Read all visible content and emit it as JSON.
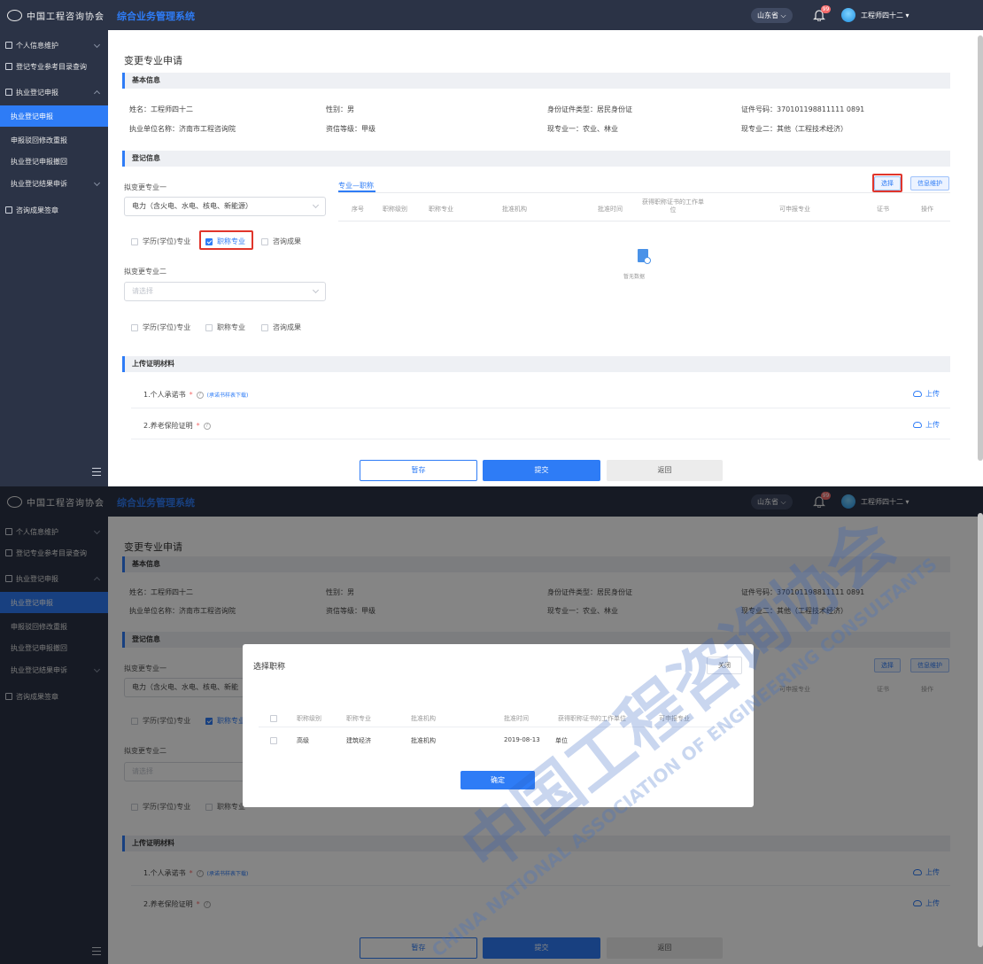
{
  "app": {
    "logo_text": "中国工程咨询协会",
    "title": "综合业务管理系统",
    "province": "山东省",
    "bell_badge": "99",
    "user": "工程师四十二"
  },
  "sidebar": {
    "items": [
      {
        "label": "个人信息维护"
      },
      {
        "label": "登记专业参考目录查询"
      },
      {
        "label": "执业登记申报"
      },
      {
        "label": "执业登记申报"
      },
      {
        "label": "申报驳回修改重报"
      },
      {
        "label": "执业登记申报撤回"
      },
      {
        "label": "执业登记结果申诉"
      },
      {
        "label": "咨询成果签章"
      }
    ]
  },
  "page": {
    "title": "变更专业申请"
  },
  "basic": {
    "heading": "基本信息",
    "name": "姓名：工程师四十二",
    "gender": "性别：男",
    "id_type": "身份证件类型：居民身份证",
    "id_no": "证件号码：370101198811111 0891",
    "unit": "执业单位名称：济南市工程咨询院",
    "credit": "资信等级：甲级",
    "major1": "现专业一：农业、林业",
    "major2": "现专业二：其他（工程技术经济）"
  },
  "registration": {
    "heading": "登记信息",
    "change1_label": "拟变更专业一",
    "change1_value": "电力（含火电、水电、核电、新能源）",
    "change1_value_short": "电力（含火电、水电、核电、新能",
    "change2_label": "拟变更专业二",
    "change2_placeholder": "请选择",
    "opt_degree": "学历(学位)专业",
    "opt_title": "职称专业",
    "opt_result": "咨询成果",
    "tab": "专业—职称",
    "btn_choose": "选择",
    "btn_maint": "信息维护",
    "columns": [
      "序号",
      "职称级别",
      "职称专业",
      "批准机构",
      "批准时间",
      "获得职称证书的工作单位",
      "可申报专业",
      "证书",
      "操作"
    ],
    "empty": "暂无数据"
  },
  "upload": {
    "heading": "上传证明材料",
    "item1": "1.个人承诺书",
    "item1_link": "(承诺书样表下载)",
    "item2": "2.养老保险证明",
    "req": "*",
    "help": "?",
    "btn": "上传"
  },
  "actions": {
    "save": "暂存",
    "submit": "提交",
    "back": "返回"
  },
  "modal": {
    "title": "选择职称",
    "close": "关闭",
    "columns": [
      "职称级别",
      "职称专业",
      "批准机构",
      "批准时间",
      "获得职称证书的工作单位",
      "可申报专业"
    ],
    "rows": [
      {
        "level": "高级",
        "major": "建筑经济",
        "org": "批准机构",
        "date": "2019-08-13",
        "unit": "单位",
        "applicable": ""
      }
    ],
    "confirm": "确定"
  },
  "watermark": {
    "text1": "CHINA NATIONAL ASSOCIATION OF ENGINEERING CONSULTANTS",
    "text2": "中国工程咨询协会"
  },
  "colors": {
    "primary": "#2e7cf6",
    "sidebar": "#2b3346",
    "highlight": "#e0352b"
  }
}
